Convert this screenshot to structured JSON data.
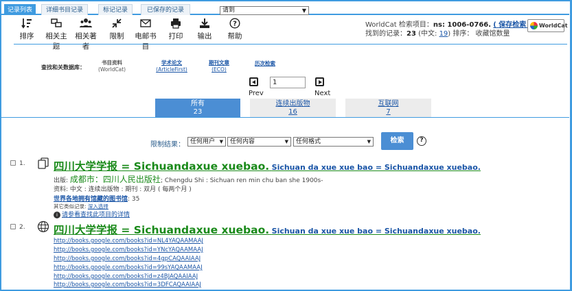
{
  "top_tabs": [
    "记录列表",
    "详细书目记录",
    "标记记录",
    "已保存的记录"
  ],
  "goto_select": "请到",
  "toolbar": [
    {
      "label": "排序",
      "icon": "sort-icon"
    },
    {
      "label": "相关主题",
      "icon": "related-subjects-icon"
    },
    {
      "label": "相关著者",
      "icon": "related-authors-icon"
    },
    {
      "label": "限制",
      "icon": "limit-icon"
    },
    {
      "label": "电邮书目",
      "icon": "email-icon"
    },
    {
      "label": "打印",
      "icon": "print-icon"
    },
    {
      "label": "输出",
      "icon": "export-icon"
    },
    {
      "label": "帮助",
      "icon": "help-icon"
    }
  ],
  "worldcat": {
    "line1_prefix": "WorldCat 检索项目：",
    "query": "ns: 1006-0766.",
    "save_search": "( 保存检索 )",
    "line2_prefix": "找到的记录：",
    "count": "23",
    "chinese_prefix": "(中文: ",
    "chinese_count": "19",
    "sort_text": ") 排序： 收藏馆数量",
    "logo_text": "WorldCat"
  },
  "related_db": {
    "label": "查找和关数据库：",
    "items": [
      {
        "title": "书目资料",
        "sub": "(WorldCat)"
      },
      {
        "title": "学术论文",
        "sub": "(ArticleFirst)"
      },
      {
        "title": "期刊文章",
        "sub": "(ECO)"
      }
    ],
    "history": "历次检索"
  },
  "pager": {
    "page": "1",
    "prev": "Prev",
    "next": "Next"
  },
  "result_tabs": [
    {
      "label": "所有",
      "count": "23"
    },
    {
      "label": "连续出版物",
      "count": "16"
    },
    {
      "label": "互联网",
      "count": "7"
    }
  ],
  "limit": {
    "label": "限制结果：",
    "users": "任何用户",
    "content": "任何内容",
    "format": "任何格式",
    "search_button": "检索"
  },
  "results": [
    {
      "num": "1.",
      "title": "四川大学学报 = Sichuandaxue xuebao.",
      "title_romanized": "Sichuan da xue xue bao = Sichuandaxue xuebao.",
      "pub_label": "出版:",
      "pub_cn": "成都市：四川人民出版社",
      "pub_rest": "; Chengdu Shi : Sichuan ren min chu ban she 1900s-",
      "material": "资料: 中文 : 连续出版物 : 期刊 : 双月 ( 每两个月 )",
      "holdings_label": "世界各地拥有馆藏的图书馆",
      "holdings_count": ": 35",
      "other_label": "其它类似记录: ",
      "other_link": "深入选择",
      "detail": "请参看查找此项目的详情"
    },
    {
      "num": "2.",
      "title": "四川大学学报 = Sichuandaxue xuebao.",
      "title_romanized": "Sichuan da xue xue bao = Sichuandaxue xuebao.",
      "urls": [
        "http://books.google.com/books?id=NL4YAQAAMAAJ",
        "http://books.google.com/books?id=YNcYAQAAMAAJ",
        "http://books.google.com/books?id=4gpCAQAAIAAJ",
        "http://books.google.com/books?id=99sYAQAAMAAJ",
        "http://books.google.com/books?id=z4BJAQAAIAAJ",
        "http://books.google.com/books?id=3DFCAQAAIAAJ"
      ]
    }
  ]
}
